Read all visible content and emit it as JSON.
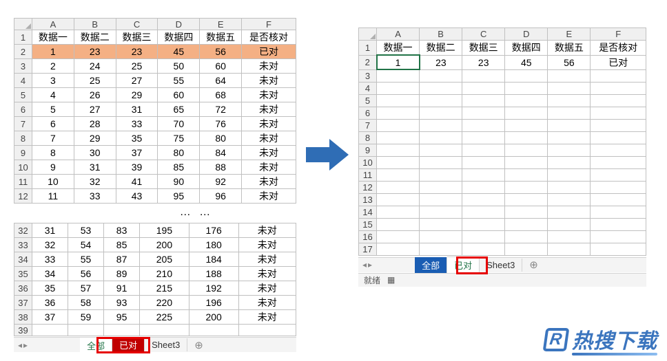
{
  "columns": [
    "A",
    "B",
    "C",
    "D",
    "E",
    "F"
  ],
  "headers": [
    "数据一",
    "数据二",
    "数据三",
    "数据四",
    "数据五",
    "是否核对"
  ],
  "left_top_rows": [
    [
      1,
      23,
      23,
      45,
      56,
      "已对"
    ],
    [
      2,
      24,
      25,
      50,
      60,
      "未对"
    ],
    [
      3,
      25,
      27,
      55,
      64,
      "未对"
    ],
    [
      4,
      26,
      29,
      60,
      68,
      "未对"
    ],
    [
      5,
      27,
      31,
      65,
      72,
      "未对"
    ],
    [
      6,
      28,
      33,
      70,
      76,
      "未对"
    ],
    [
      7,
      29,
      35,
      75,
      80,
      "未对"
    ],
    [
      8,
      30,
      37,
      80,
      84,
      "未对"
    ],
    [
      9,
      31,
      39,
      85,
      88,
      "未对"
    ],
    [
      10,
      32,
      41,
      90,
      92,
      "未对"
    ],
    [
      11,
      33,
      43,
      95,
      96,
      "未对"
    ]
  ],
  "left_bottom_start": 32,
  "left_bottom_rows": [
    [
      31,
      53,
      83,
      195,
      176,
      "未对"
    ],
    [
      32,
      54,
      85,
      200,
      180,
      "未对"
    ],
    [
      33,
      55,
      87,
      205,
      184,
      "未对"
    ],
    [
      34,
      56,
      89,
      210,
      188,
      "未对"
    ],
    [
      35,
      57,
      91,
      215,
      192,
      "未对"
    ],
    [
      36,
      58,
      93,
      220,
      196,
      "未对"
    ],
    [
      37,
      59,
      95,
      225,
      200,
      "未对"
    ]
  ],
  "left_empty_row": 39,
  "right_rows": [
    [
      1,
      23,
      23,
      45,
      56,
      "已对"
    ]
  ],
  "right_empty_rows": [
    3,
    4,
    5,
    6,
    7,
    8,
    9,
    10,
    11,
    12,
    13,
    14,
    15,
    16,
    17
  ],
  "tabs": {
    "quanbu": "全部",
    "yidui": "已对",
    "sheet3": "Sheet3"
  },
  "status": {
    "ready": "就绪"
  },
  "ellipsis": "… …",
  "watermark": "热搜下载"
}
